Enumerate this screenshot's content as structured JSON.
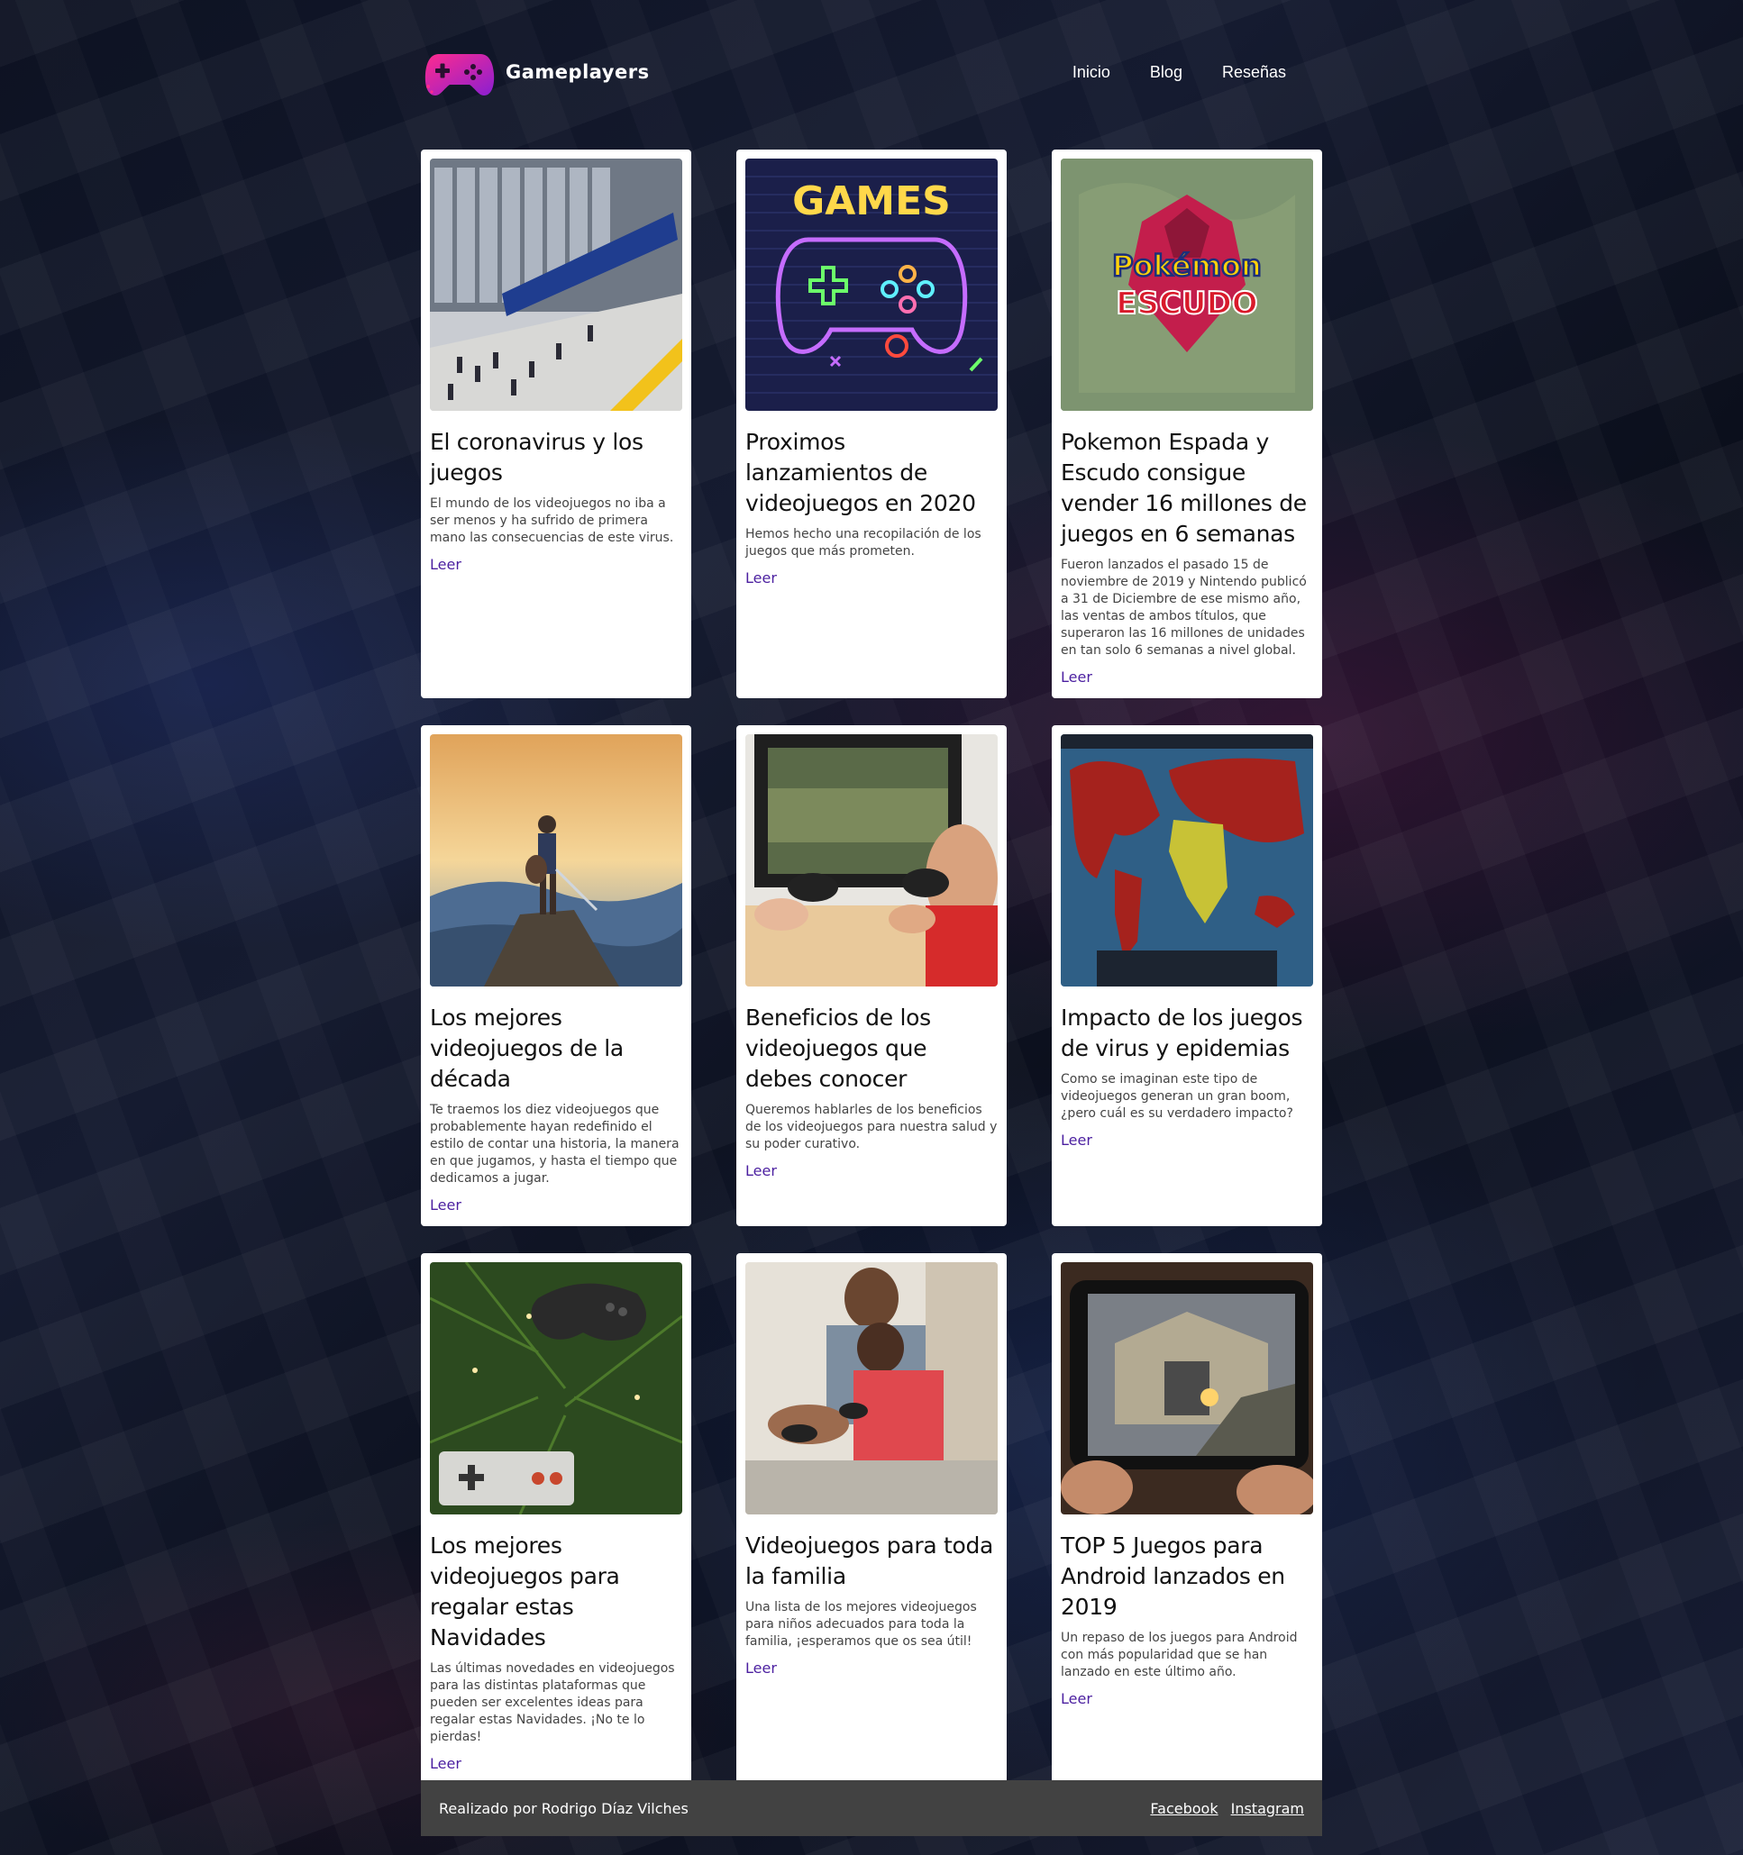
{
  "brand": {
    "name": "Gameplayers",
    "icon": "gamepad-logo-icon",
    "accent": "#e0197d"
  },
  "nav": {
    "items": [
      "Inicio",
      "Blog",
      "Reseñas"
    ]
  },
  "cards": [
    {
      "title": "El coronavirus y los juegos",
      "text": "El mundo de los videojuegos no iba a ser menos y ha sufrido de primera mano las consecuencias de este virus.",
      "link": "Leer",
      "image": "conference-building-image"
    },
    {
      "title": "Proximos lanzamientos de videojuegos en 2020",
      "text": "Hemos hecho una recopilación de los juegos que más prometen.",
      "link": "Leer",
      "image": "neon-games-controller-image",
      "image_text": "GAMES"
    },
    {
      "title": "Pokemon Espada y Escudo consigue vender 16 millones de juegos en 6 semanas",
      "text": "Fueron lanzados el pasado 15 de noviembre de 2019 y Nintendo publicó a 31 de Diciembre de ese mismo año, las ventas de ambos títulos, que superaron las 16 millones de unidades en tan solo 6 semanas a nivel global.",
      "link": "Leer",
      "image": "pokemon-shield-logo-image",
      "image_text_1": "Pokémon",
      "image_text_2": "ESCUDO"
    },
    {
      "title": "Los mejores videojuegos de la década",
      "text": "Te traemos los diez videojuegos que probablemente hayan redefinido el estilo de contar una historia, la manera en que jugamos, y hasta el tiempo que dedicamos a jugar.",
      "link": "Leer",
      "image": "hero-on-cliff-image"
    },
    {
      "title": "Beneficios de los videojuegos que debes conocer",
      "text": "Queremos hablarles de los beneficios de los videojuegos para nuestra salud y su poder curativo.",
      "link": "Leer",
      "image": "kids-playing-console-image"
    },
    {
      "title": "Impacto de los juegos de virus y epidemias",
      "text": "Como se imaginan este tipo de videojuegos generan un gran boom, ¿pero cuál es su verdadero impacto?",
      "link": "Leer",
      "image": "infected-world-map-image"
    },
    {
      "title": "Los mejores videojuegos para regalar estas Navidades",
      "text": "Las últimas novedades en videojuegos para las distintas plataformas que pueden ser excelentes ideas para regalar estas Navidades. ¡No te lo pierdas!",
      "link": "Leer",
      "image": "controllers-on-christmas-tree-image"
    },
    {
      "title": "Videojuegos para toda la familia",
      "text": "Una lista de los mejores videojuegos para niños adecuados para toda la familia, ¡esperamos que os sea útil!",
      "link": "Leer",
      "image": "family-gaming-image"
    },
    {
      "title": "TOP 5 Juegos para Android lanzados en 2019",
      "text": "Un repaso de los juegos para Android con más popularidad que se han lanzado en este último año.",
      "link": "Leer",
      "image": "mobile-shooter-game-image"
    }
  ],
  "footer": {
    "credit": "Realizado por Rodrigo Díaz Vilches",
    "links": [
      "Facebook",
      "Instagram"
    ]
  }
}
